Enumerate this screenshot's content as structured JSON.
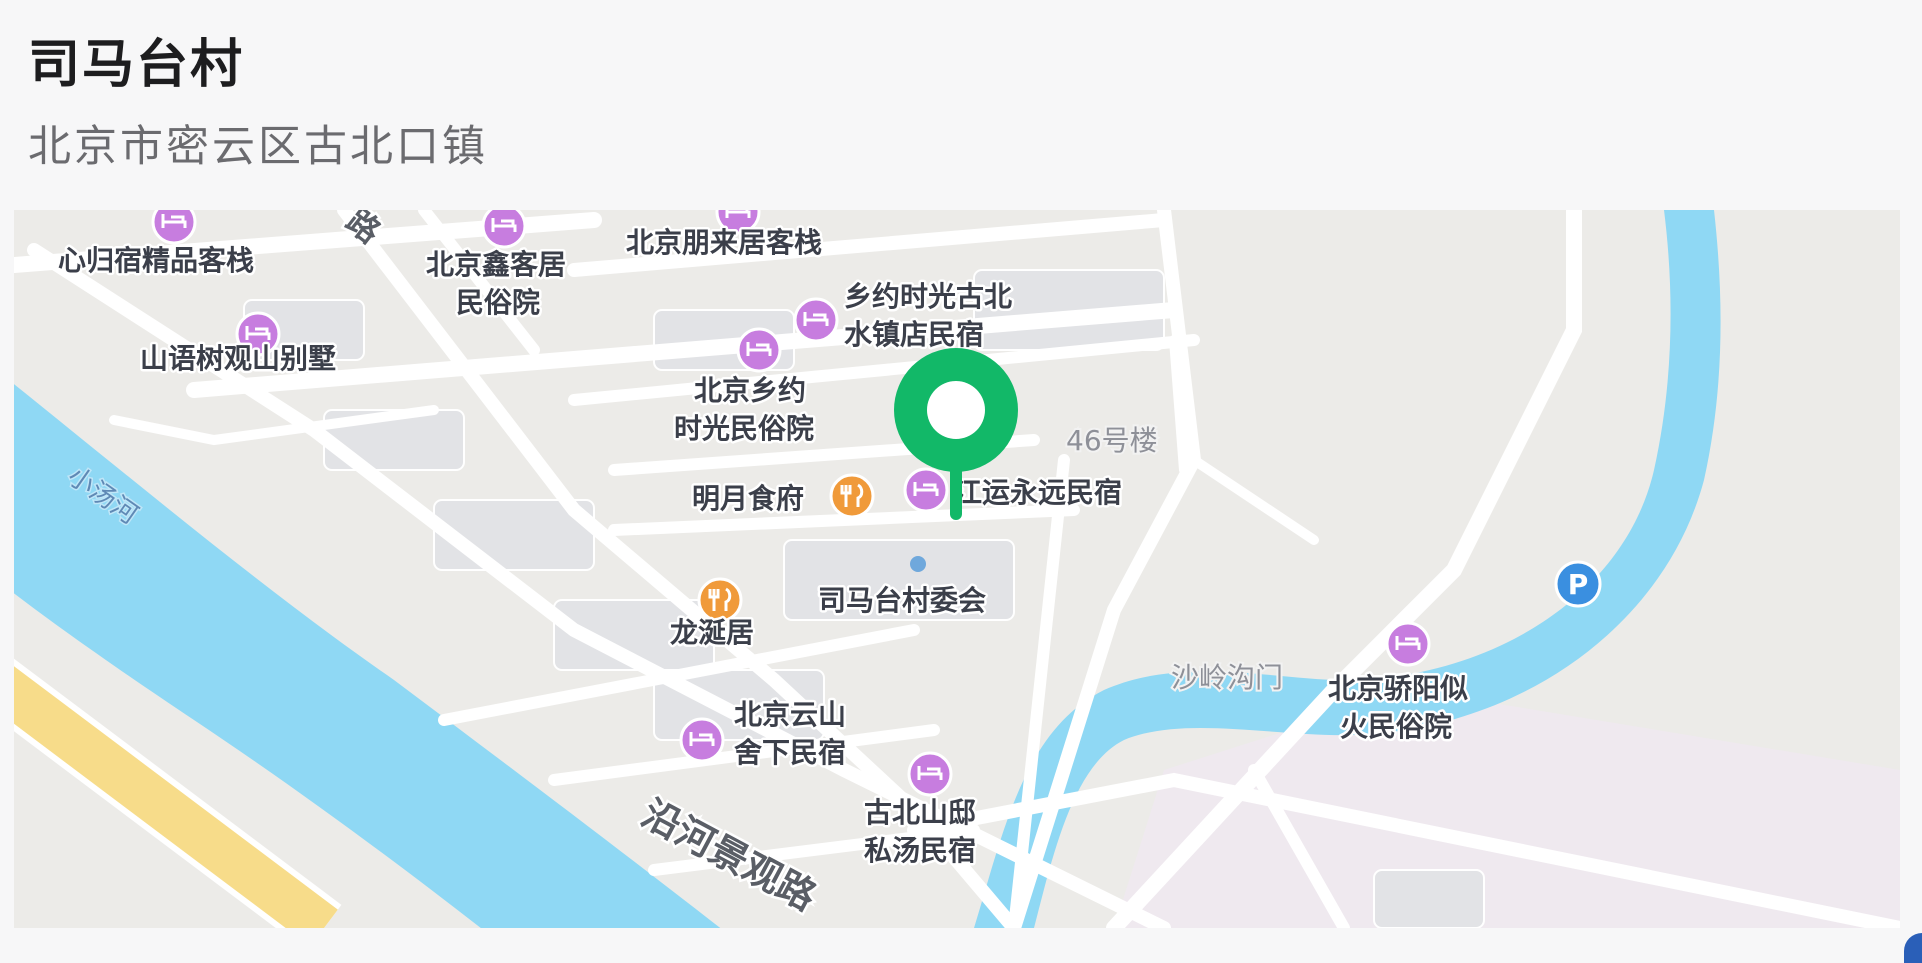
{
  "place": {
    "title": "司马台村",
    "address": "北京市密云区古北口镇"
  },
  "map": {
    "water_label": "小汤河",
    "road_labels": [
      "路",
      "沿河景观路"
    ],
    "building_labels": [
      "46号楼",
      "沙岭沟门"
    ],
    "pois": [
      {
        "name": "心归宿精品客栈",
        "kind": "hotel"
      },
      {
        "name": "北京鑫客居",
        "kind": "hotel"
      },
      {
        "name": "民俗院",
        "kind": "text"
      },
      {
        "name": "北京朋来居客栈",
        "kind": "hotel"
      },
      {
        "name": "乡约时光古北",
        "kind": "hotel"
      },
      {
        "name": "水镇店民宿",
        "kind": "text"
      },
      {
        "name": "山语树观山别墅",
        "kind": "hotel"
      },
      {
        "name": "北京乡约",
        "kind": "hotel"
      },
      {
        "name": "时光民俗院",
        "kind": "text"
      },
      {
        "name": "明月食府",
        "kind": "restaurant"
      },
      {
        "name": "江运永远民宿",
        "kind": "hotel"
      },
      {
        "name": "司马台村委会",
        "kind": "dot"
      },
      {
        "name": "龙涎居",
        "kind": "restaurant"
      },
      {
        "name": "北京骄阳似",
        "kind": "hotel"
      },
      {
        "name": "火民俗院",
        "kind": "text"
      },
      {
        "name": "北京云山",
        "kind": "hotel"
      },
      {
        "name": "舍下民宿",
        "kind": "text"
      },
      {
        "name": "古北山邸",
        "kind": "hotel"
      },
      {
        "name": "私汤民宿",
        "kind": "text"
      }
    ],
    "parking_label": "P",
    "colors": {
      "water": "#8fd8f4",
      "road": "#ffffff",
      "highway": "#f7dc8a",
      "hotel": "#c77ddf",
      "restaurant": "#f09a3a",
      "parking": "#3a8fe0",
      "marker": "#12b868"
    },
    "icons": {
      "hotel": "bed-icon",
      "restaurant": "fork-knife-icon",
      "parking": "parking-icon",
      "marker": "location-pin-icon"
    }
  }
}
